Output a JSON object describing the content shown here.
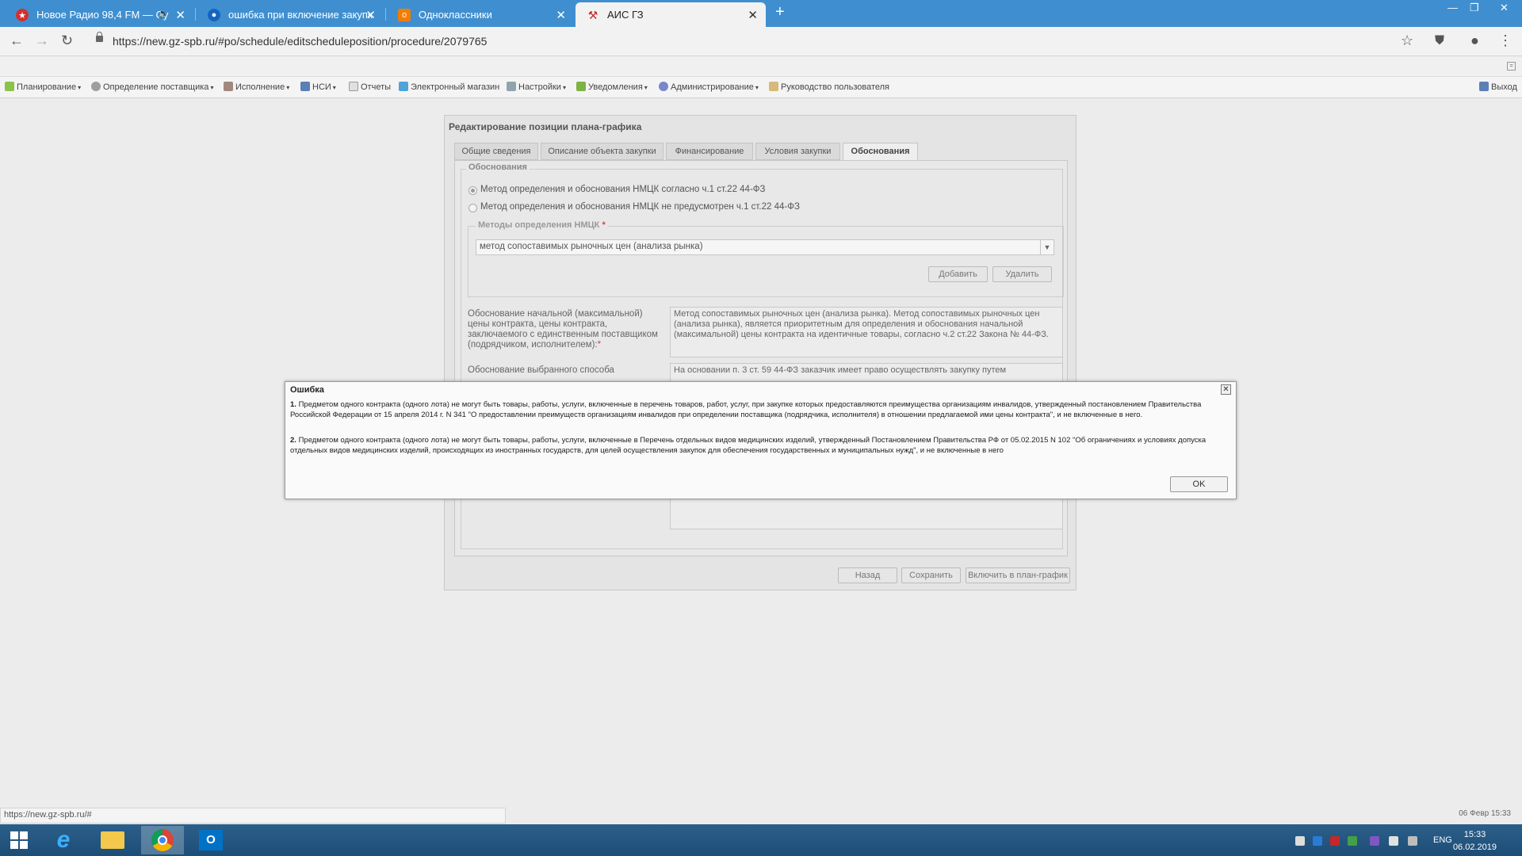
{
  "browser": {
    "tabs": [
      {
        "label": "Новое Радио 98,4 FM — Су",
        "icon": "star-icon",
        "icon_color": "#d32f2f",
        "has_audio": true
      },
      {
        "label": "ошибка при включение закупк",
        "icon": "globe-icon",
        "icon_color": "#1565c0"
      },
      {
        "label": "Одноклассники",
        "icon": "ok-icon",
        "icon_color": "#f57c00"
      },
      {
        "label": "АИС ГЗ",
        "icon": "gavel-icon",
        "icon_color": "#c62828",
        "active": true
      }
    ],
    "url": "https://new.gz-spb.ru/#po/schedule/editscheduleposition/procedure/2079765",
    "status_url": "https://new.gz-spb.ru/#"
  },
  "menu": {
    "items": [
      "Планирование",
      "Определение поставщика",
      "Исполнение",
      "НСИ",
      "Отчеты",
      "Электронный магазин",
      "Настройки",
      "Уведомления",
      "Администрирование",
      "Руководство пользователя"
    ],
    "exit": "Выход"
  },
  "form": {
    "title": "Редактирование позиции плана-графика",
    "tabs": [
      "Общие сведения",
      "Описание объекта закупки",
      "Финансирование",
      "Условия закупки",
      "Обоснования"
    ],
    "active_tab": "Обоснования",
    "section_legend": "Обоснования",
    "radio_1": "Метод определения и обоснования НМЦК согласно ч.1 ст.22 44-ФЗ",
    "radio_2": "Метод определения и обоснования НМЦК не предусмотрен ч.1 ст.22 44-ФЗ",
    "methods_legend": "Методы определения НМЦК",
    "required_mark": "*",
    "method_value": "метод сопоставимых рыночных цен (анализа рынка)",
    "add_button": "Добавить",
    "delete_button": "Удалить",
    "field1_label": "Обоснование начальной (максимальной) цены контракта, цены контракта, заключаемого с единственным поставщиком (подрядчиком, исполнителем):",
    "field1_value": "Метод сопоставимых рыночных цен (анализа рынка). Метод сопоставимых рыночных цен (анализа рынка), является приоритетным для определения и обоснования начальной (максимальной) цены контракта на идентичные товары, согласно ч.2 ст.22 Закона № 44-ФЗ.",
    "field2_label": "Обоснование выбранного способа",
    "field2_value": "На основании п. 3 ст. 59 44-ФЗ заказчик имеет право осуществлять закупку путем",
    "back_button": "Назад",
    "save_button": "Сохранить",
    "include_button": "Включить в план-график"
  },
  "dialog": {
    "title": "Ошибка",
    "errors": [
      {
        "num": "1.",
        "text": "Предметом одного контракта (одного лота) не могут быть товары, работы, услуги, включенные в перечень товаров, работ, услуг, при закупке которых предоставляются преимущества организациям инвалидов, утвержденный постановлением Правительства Российской Федерации от 15 апреля 2014 г. N 341 \"О предоставлении преимуществ организациям инвалидов при определении поставщика (подрядчика, исполнителя) в отношении предлагаемой ими цены контракта\", и не включенные в него."
      },
      {
        "num": "2.",
        "text": "Предметом одного контракта (одного лота) не могут быть товары, работы, услуги, включенные в Перечень отдельных видов медицинских изделий, утвержденный Постановлением Правительства РФ от 05.02.2015 N 102 \"Об ограничениях и условиях допуска отдельных видов медицинских изделий, происходящих из иностранных государств, для целей осуществления закупок для обеспечения государственных и муниципальных нужд\", и не включенные в него"
      }
    ],
    "ok_button": "OK"
  },
  "status": {
    "date": "06 Февр 15:33"
  },
  "taskbar": {
    "lang": "ENG",
    "time": "15:33",
    "date": "06.02.2019"
  }
}
